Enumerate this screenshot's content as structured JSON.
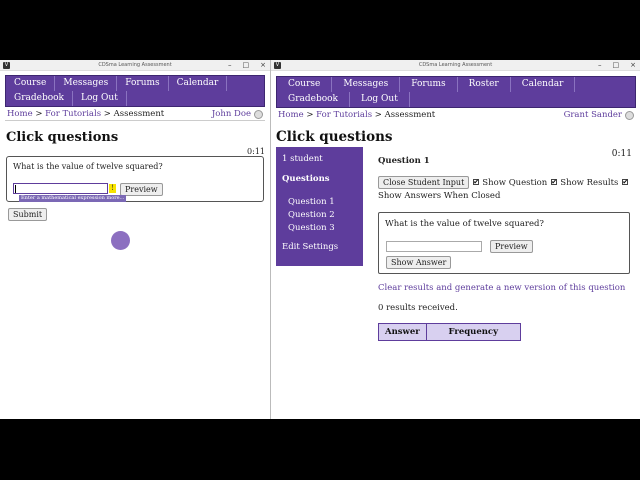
{
  "left_window": {
    "title": "CDSma Learning Assessment",
    "nav": [
      "Course",
      "Messages",
      "Forums",
      "Calendar",
      "Gradebook",
      "Log Out"
    ],
    "breadcrumb": {
      "home": "Home",
      "sep1": " > ",
      "tutorials": "For Tutorials",
      "sep2": " > ",
      "current": "Assessment"
    },
    "user_name": "John Doe",
    "page_title": "Click questions",
    "timer": "0:11",
    "question_text": "What is the value of twelve squared?",
    "answer_value": "",
    "warning_glyph": "!",
    "preview_label": "Preview",
    "hint_text": "Enter a mathematical expression  more...",
    "submit_label": "Submit"
  },
  "right_window": {
    "title": "CDSma Learning Assessment",
    "nav": [
      "Course",
      "Messages",
      "Forums",
      "Roster",
      "Calendar",
      "Gradebook",
      "Log Out"
    ],
    "breadcrumb": {
      "home": "Home",
      "sep1": " > ",
      "tutorials": "For Tutorials",
      "sep2": " > ",
      "current": "Assessment"
    },
    "user_name": "Grant Sander",
    "page_title": "Click questions",
    "timer": "0:11",
    "side_menu": {
      "students": "1 student",
      "questions_heading": "Questions",
      "items": [
        "Question 1",
        "Question 2",
        "Question 3"
      ],
      "edit": "Edit Settings"
    },
    "question_heading": "Question 1",
    "close_input_label": "Close Student Input",
    "options": [
      {
        "label": "Show Question",
        "checked": true
      },
      {
        "label": "Show Results",
        "checked": true
      },
      {
        "label": "Show Answers When Closed",
        "checked": true
      }
    ],
    "preview_question": "What is the value of twelve squared?",
    "preview_label": "Preview",
    "show_answer_label": "Show Answer",
    "clear_link": "Clear results and generate a new version of this question",
    "results_text": "0 results received.",
    "table_headers": [
      "Answer",
      "Frequency"
    ]
  },
  "colors": {
    "accent": "#5e3d9c",
    "table_header_bg": "#d8d0f0"
  }
}
